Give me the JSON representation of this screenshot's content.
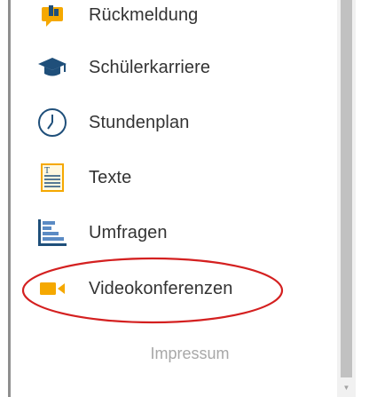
{
  "menu": {
    "items": [
      {
        "label": "Rückmeldung",
        "icon": "feedback-icon"
      },
      {
        "label": "Schülerkarriere",
        "icon": "graduation-cap-icon"
      },
      {
        "label": "Stundenplan",
        "icon": "clock-icon"
      },
      {
        "label": "Texte",
        "icon": "document-text-icon"
      },
      {
        "label": "Umfragen",
        "icon": "bar-chart-icon"
      },
      {
        "label": "Videokonferenzen",
        "icon": "video-camera-icon"
      }
    ]
  },
  "footer": {
    "impressum": "Impressum"
  },
  "scrollbar": {
    "down_arrow": "▼"
  },
  "colors": {
    "text": "#333333",
    "icon_orange": "#f5a800",
    "icon_blue": "#1f4f7a",
    "annotation_red": "#d42020",
    "muted": "#a8a8a8"
  }
}
